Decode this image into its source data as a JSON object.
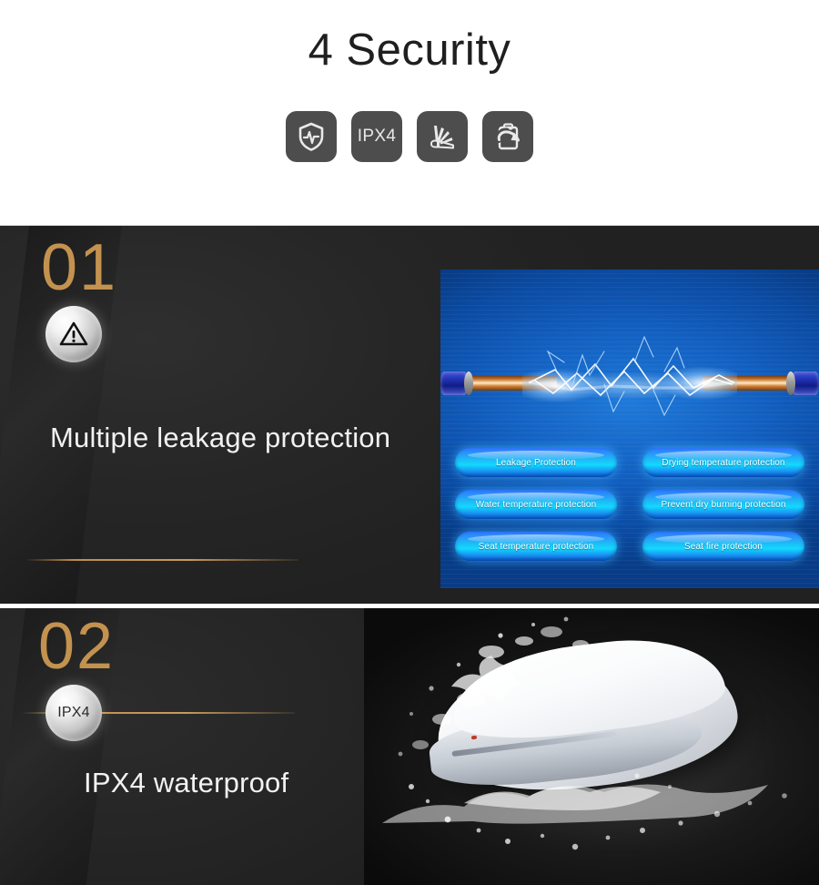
{
  "header": {
    "title": "4 Security",
    "icons": [
      {
        "name": "shield-pulse-icon",
        "label": ""
      },
      {
        "name": "ipx4-icon",
        "label": "IPX4"
      },
      {
        "name": "spray-nozzle-icon",
        "label": ""
      },
      {
        "name": "clipboard-refresh-icon",
        "label": ""
      }
    ]
  },
  "sections": [
    {
      "number": "01",
      "badge_icon": "warning-triangle-icon",
      "badge_label": "",
      "headline": "Multiple leakage protection",
      "panel": {
        "type": "electric-arc-illustration",
        "pills_left": [
          "Leakage Protection",
          "Water temperature protection",
          "Seat temperature protection"
        ],
        "pills_right": [
          "Drying temperature protection",
          "Prevent dry burning protection",
          "Seat fire protection"
        ]
      }
    },
    {
      "number": "02",
      "badge_icon": "ipx4-badge",
      "badge_label": "IPX4",
      "headline": "IPX4 waterproof",
      "panel": {
        "type": "toilet-seat-water-splash-photo"
      }
    }
  ],
  "colors": {
    "gold": "#c3924f",
    "dark_bg": "#252525",
    "panel_blue": "#125fc0",
    "pill_cyan": "#12d9ff",
    "icon_gray": "#4d4d4d",
    "title_text": "#1f1f1f",
    "headline_text": "#f2f2f2"
  }
}
